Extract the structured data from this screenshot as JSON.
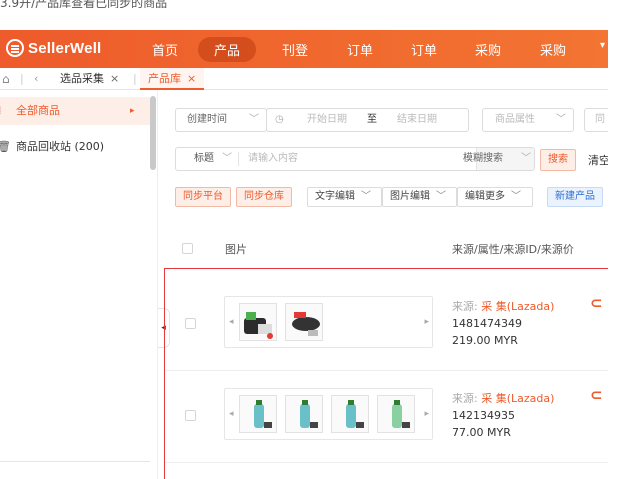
{
  "caption": "3.9开/产品库查看已同步的商品",
  "brand": {
    "logo_text": "SellerWell",
    "accent": "#ee5b2c"
  },
  "nav": {
    "items": [
      "首页",
      "产品",
      "刊登",
      "订单",
      "订单",
      "采购",
      "采购"
    ],
    "active_index": 1
  },
  "tabs": {
    "home_icon": "home-icon",
    "items": [
      "选品采集",
      "产品库"
    ],
    "close_glyph": "×"
  },
  "sidebar": {
    "items": [
      "全部商品",
      "商品回收站 (200)"
    ]
  },
  "filters": {
    "created_time": "创建时间",
    "start_date": "开始日期",
    "to": "至",
    "end_date": "结束日期",
    "product_attr": "商品属性",
    "cut_text": "同",
    "title_select": "标题",
    "content_placeholder": "请输入内容",
    "fuzzy_search": "模糊搜索",
    "search_btn": "搜索",
    "clear_btn": "清空"
  },
  "toolbar": {
    "sync_platform": "同步平台",
    "sync_warehouse": "同步仓库",
    "text_edit": "文字编辑",
    "image_edit": "图片编辑",
    "edit_more": "编辑更多",
    "new_product": "新建产品"
  },
  "table": {
    "headers": [
      "图片",
      "来源/属性/来源ID/来源价"
    ],
    "rows": [
      {
        "source_label": "来源:",
        "source_value": "采 集(Lazada)",
        "source_id": "1481474349",
        "price": "219.00  MYR",
        "thumbs": 2
      },
      {
        "source_label": "来源:",
        "source_value": "采 集(Lazada)",
        "source_id": "142134935",
        "price": "77.00  MYR",
        "thumbs": 4
      }
    ]
  }
}
